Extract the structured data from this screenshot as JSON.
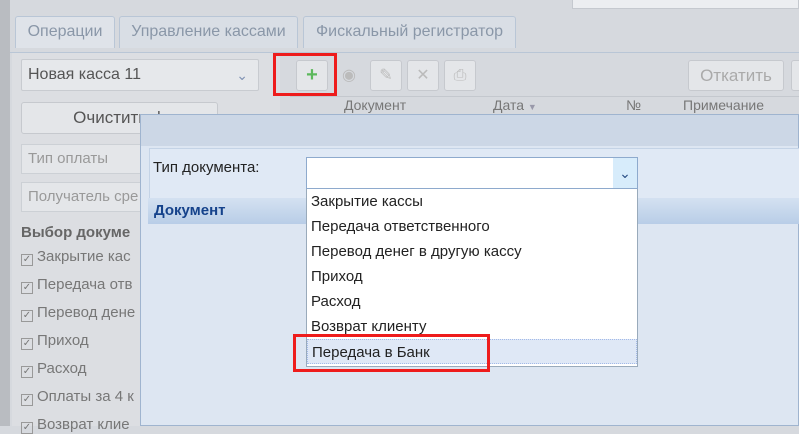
{
  "tabs": [
    "Операции",
    "Управление кассами",
    "Фискальный регистратор"
  ],
  "cash_select": "Новая касса 11",
  "clear_button": "Очистить ф",
  "fields": {
    "payment_type": "Тип оплаты",
    "recipient": "Получатель сре"
  },
  "doc_choice_title": "Выбор докуме",
  "doc_checks": [
    "Закрытие кас",
    "Передача отв",
    "Перевод дене",
    "Приход",
    "Расход",
    "Оплаты за 4 к",
    "Возврат клие"
  ],
  "toolbar": {
    "rollback": "Откатить"
  },
  "columns": [
    "Документ",
    "Дата",
    "№",
    "Примечание"
  ],
  "modal": {
    "doc_type_label": "Тип документа:",
    "doc_section": "Документ",
    "options": [
      "Закрытие кассы",
      "Передача ответственного",
      "Перевод денег в другую кассу",
      "Приход",
      "Расход",
      "Возврат клиенту",
      "Передача в Банк"
    ]
  }
}
